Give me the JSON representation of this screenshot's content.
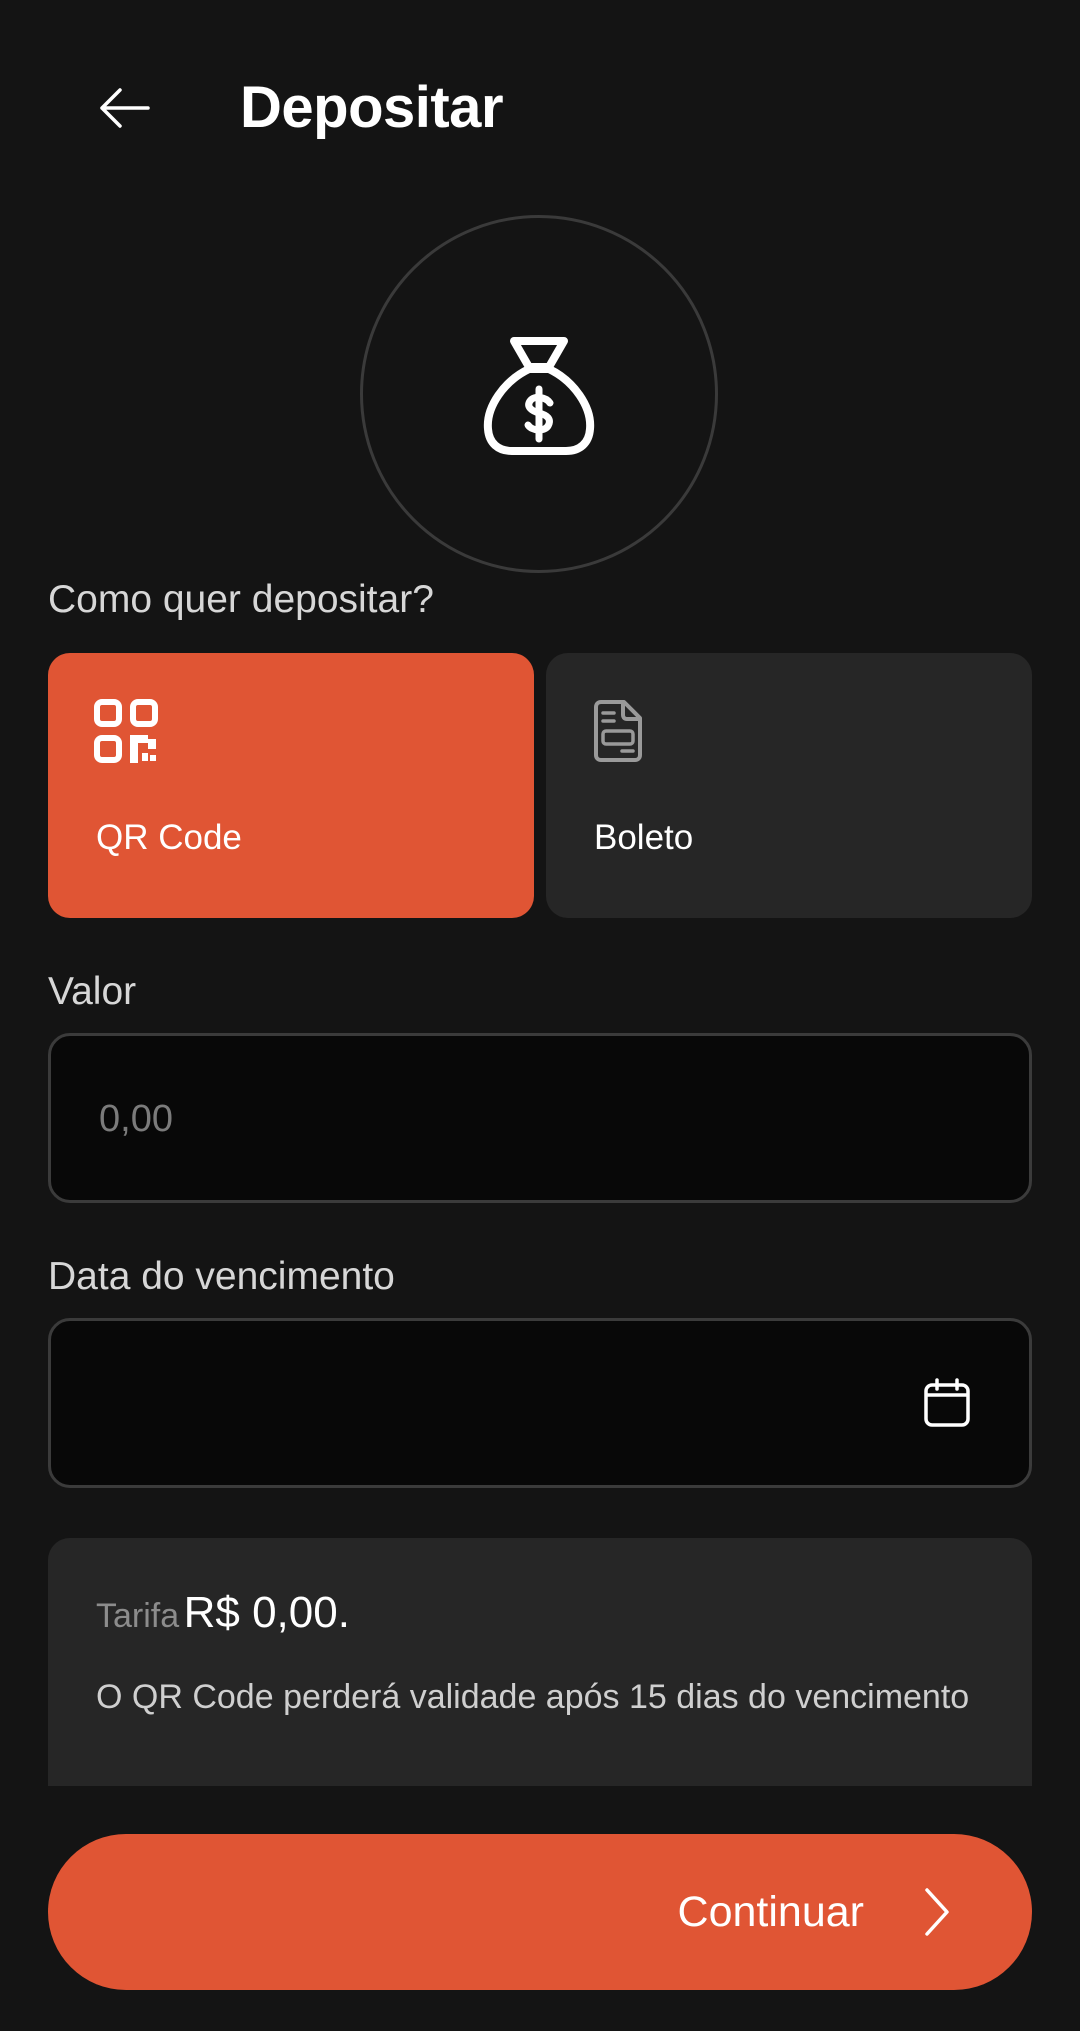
{
  "header": {
    "title": "Depositar"
  },
  "icons": {
    "back": "arrow-left-icon",
    "hero": "money-bag-icon",
    "qr": "qr-code-icon",
    "boleto": "document-icon",
    "calendar": "calendar-icon",
    "continue": "chevron-right-icon"
  },
  "method_section": {
    "label": "Como quer depositar?",
    "options": [
      {
        "label": "QR Code",
        "selected": true
      },
      {
        "label": "Boleto",
        "selected": false
      }
    ]
  },
  "amount": {
    "label": "Valor",
    "placeholder": "0,00",
    "value": ""
  },
  "due_date": {
    "label": "Data do vencimento",
    "value": ""
  },
  "info": {
    "fee_label": "Tarifa",
    "fee_value": "R$ 0,00.",
    "note": "O QR Code perderá validade após 15 dias do vencimento"
  },
  "footer": {
    "continue_label": "Continuar"
  },
  "colors": {
    "accent": "#e05534",
    "background": "#141414",
    "card": "#262626"
  }
}
